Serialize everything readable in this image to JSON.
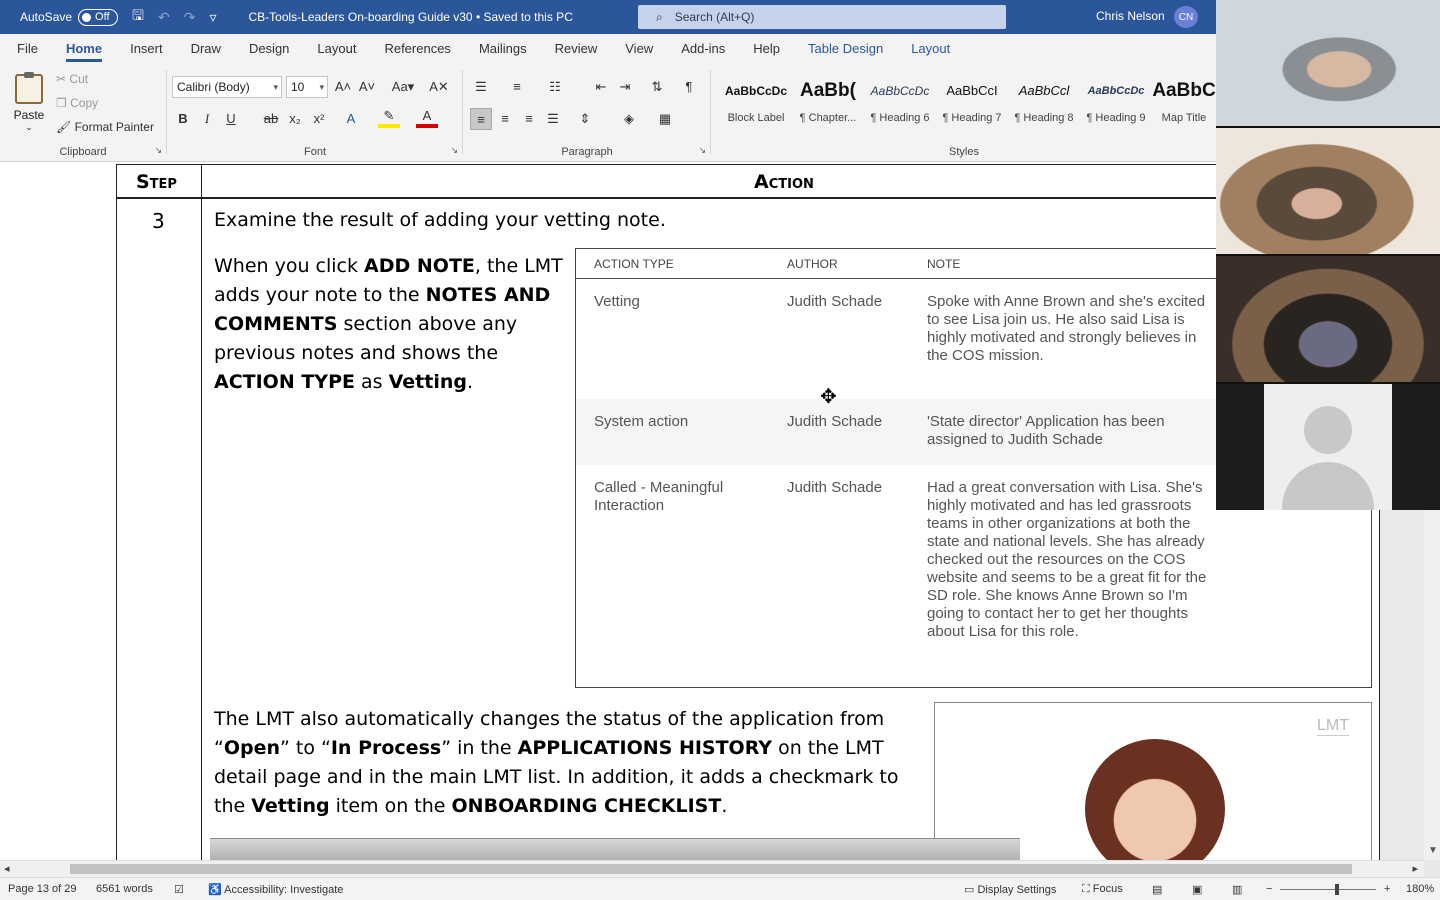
{
  "titlebar": {
    "autosave_label": "AutoSave",
    "autosave_state": "Off",
    "document_title": "CB-Tools-Leaders On-boarding Guide v30  •  Saved to this PC",
    "search_placeholder": "Search (Alt+Q)",
    "user_name": "Chris Nelson",
    "user_initials": "CN"
  },
  "tabs": [
    "File",
    "Home",
    "Insert",
    "Draw",
    "Design",
    "Layout",
    "References",
    "Mailings",
    "Review",
    "View",
    "Add-ins",
    "Help",
    "Table Design",
    "Layout"
  ],
  "ribbon": {
    "clipboard": {
      "paste": "Paste",
      "cut": "Cut",
      "copy": "Copy",
      "format_painter": "Format Painter",
      "label": "Clipboard"
    },
    "font": {
      "name": "Calibri (Body)",
      "size": "10",
      "label": "Font"
    },
    "paragraph": {
      "label": "Paragraph"
    },
    "styles": {
      "label": "Styles",
      "items": [
        {
          "sample": "AaBbCcDc",
          "name": "Block Label"
        },
        {
          "sample": "AaBb(",
          "name": "¶ Chapter..."
        },
        {
          "sample": "AaBbCcDc",
          "name": "¶ Heading 6"
        },
        {
          "sample": "AaBbCcI",
          "name": "¶ Heading 7"
        },
        {
          "sample": "AaBbCcl",
          "name": "¶ Heading 8"
        },
        {
          "sample": "AaBbCcDc",
          "name": "¶ Heading 9"
        },
        {
          "sample": "AaBbC",
          "name": "Map Title"
        }
      ]
    }
  },
  "document": {
    "header_step": "Step",
    "header_action": "Action",
    "step_number": "3",
    "intro": "Examine the result of adding your vetting note.",
    "para1": [
      {
        "t": "When you click ",
        "b": false
      },
      {
        "t": "ADD NOTE",
        "b": true
      },
      {
        "t": ", the LMT adds your note to the ",
        "b": false
      },
      {
        "t": "NOTES AND COMMENTS",
        "b": true
      },
      {
        "t": " section above any previous notes and shows the ",
        "b": false
      },
      {
        "t": "ACTION TYPE",
        "b": true
      },
      {
        "t": " as ",
        "b": false
      },
      {
        "t": "Vetting",
        "b": true
      },
      {
        "t": ".",
        "b": false
      }
    ],
    "para2": [
      {
        "t": "The LMT also automatically changes the status of the application from “",
        "b": false
      },
      {
        "t": "Open",
        "b": true
      },
      {
        "t": "” to “",
        "b": false
      },
      {
        "t": "In Process",
        "b": true
      },
      {
        "t": "” in the ",
        "b": false
      },
      {
        "t": "APPLICATIONS HISTORY",
        "b": true
      },
      {
        "t": " on the LMT detail page and in the main LMT list. In addition, it adds a checkmark to the ",
        "b": false
      },
      {
        "t": "Vetting",
        "b": true
      },
      {
        "t": " item on the ",
        "b": false
      },
      {
        "t": "ONBOARDING CHECKLIST",
        "b": true
      },
      {
        "t": ".",
        "b": false
      }
    ],
    "notes_table": {
      "headers": [
        "ACTION TYPE",
        "AUTHOR",
        "NOTE"
      ],
      "rows": [
        {
          "type": "Vetting",
          "author": "Judith Schade",
          "note": "Spoke with Anne Brown and she's excited to see Lisa join us. He also said Lisa is highly motivated and strongly believes in the COS mission."
        },
        {
          "type": "System action",
          "author": "Judith Schade",
          "note": "'State director' Application has been assigned to Judith Schade"
        },
        {
          "type": "Called - Meaningful Interaction",
          "author": "Judith Schade",
          "note": "Had a great conversation with Lisa. She's highly motivated and has led grassroots teams in other organizations at both the state and national levels. She has already checked out the resources on the COS website and seems to be a great fit for the SD role. She knows Anne Brown so I'm going to contact her to get her thoughts about Lisa for this role."
        }
      ]
    },
    "image_logo": "LMT"
  },
  "statusbar": {
    "page": "Page 13 of 29",
    "words": "6561 words",
    "accessibility": "Accessibility: Investigate",
    "display_settings": "Display Settings",
    "focus": "Focus",
    "zoom": "180%"
  },
  "colors": {
    "accent": "#2b579a",
    "avatar": "#6a7fd8"
  }
}
